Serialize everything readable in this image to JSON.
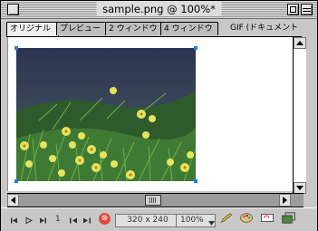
{
  "window": {
    "title": "sample.png @ 100%*"
  },
  "tabs": [
    {
      "label": "オリジナル",
      "active": true
    },
    {
      "label": "プレビュー",
      "active": false
    },
    {
      "label": "2 ウィンドウ",
      "active": false
    },
    {
      "label": "4 ウィンドウ",
      "active": false
    },
    {
      "label": "GIF (ドキュメント",
      "active": false
    }
  ],
  "status": {
    "frame_number": "1",
    "image_size": "320 x 240",
    "zoom": "100%",
    "zoom_dropdown_icon": "triangle-down-icon",
    "icons": [
      "first-frame-icon",
      "play-icon",
      "prev-frame-icon",
      "next-frame-icon",
      "stop-icon",
      "pencil-icon",
      "color-palette-icon",
      "rollover-icon",
      "window-icon"
    ]
  },
  "colors": {
    "selection_handle": "#1f7fe0",
    "stop_red": "#e14a3a"
  }
}
